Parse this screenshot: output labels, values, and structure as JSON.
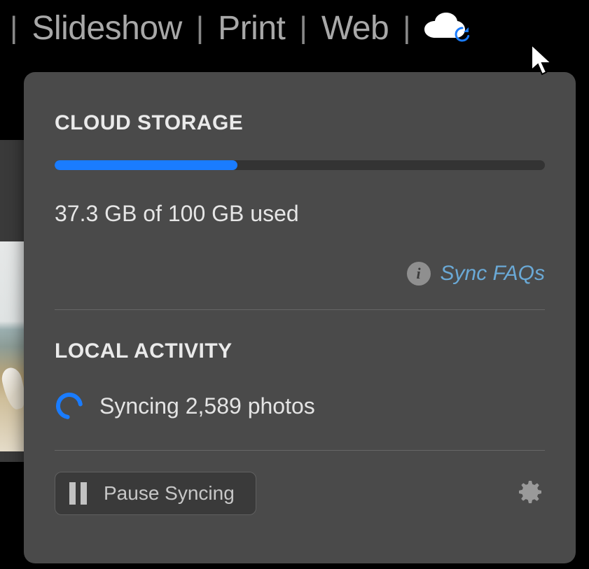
{
  "topbar": {
    "tabs": [
      "Slideshow",
      "Print",
      "Web"
    ]
  },
  "panel": {
    "cloud": {
      "title": "CLOUD STORAGE",
      "used_gb": 37.3,
      "total_gb": 100,
      "usage_text": "37.3 GB of 100 GB used",
      "progress_percent": 37.3,
      "faq_label": "Sync FAQs"
    },
    "local": {
      "title": "LOCAL ACTIVITY",
      "sync_count": 2589,
      "status_text": "Syncing 2,589 photos"
    },
    "actions": {
      "pause_label": "Pause Syncing"
    }
  }
}
